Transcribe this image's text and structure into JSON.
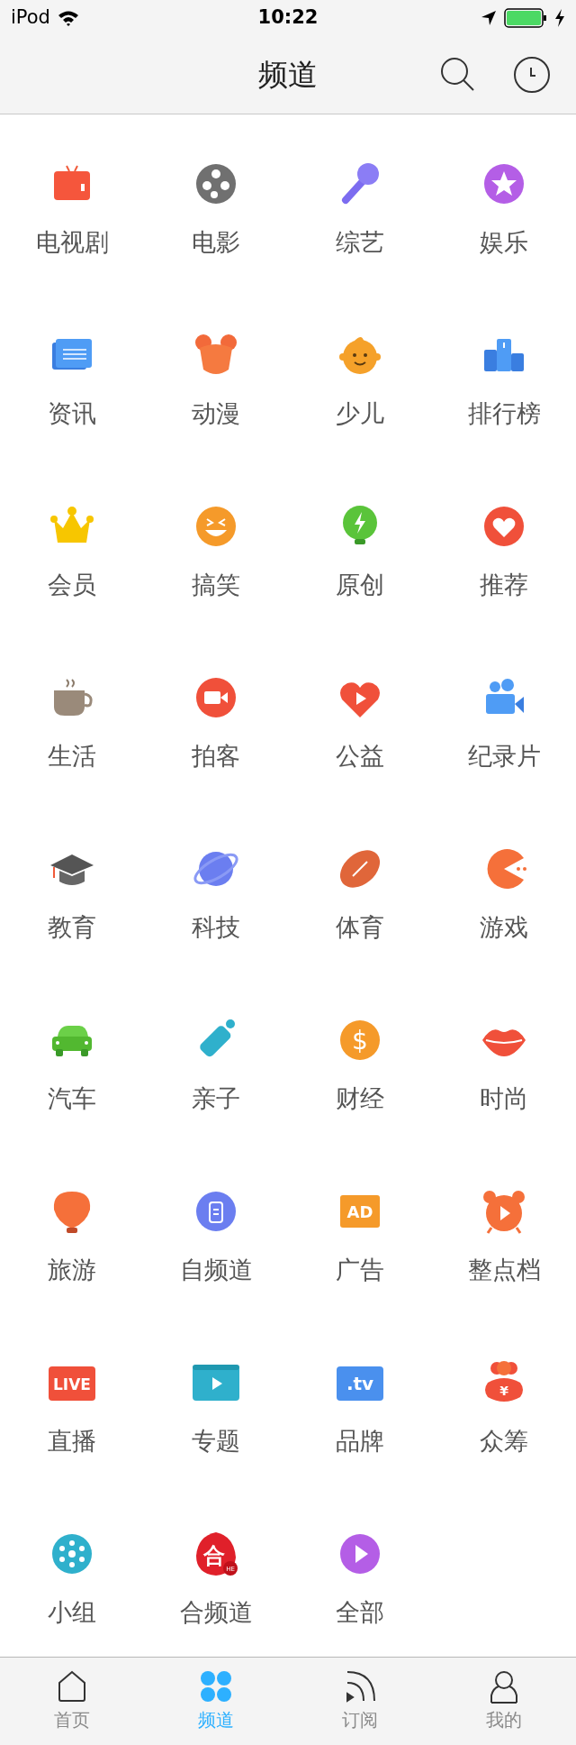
{
  "status_bar": {
    "device": "iPod",
    "time": "10:22"
  },
  "nav_bar": {
    "title": "频道"
  },
  "channels": [
    {
      "label": "电视剧"
    },
    {
      "label": "电影"
    },
    {
      "label": "综艺"
    },
    {
      "label": "娱乐"
    },
    {
      "label": "资讯"
    },
    {
      "label": "动漫"
    },
    {
      "label": "少儿"
    },
    {
      "label": "排行榜"
    },
    {
      "label": "会员"
    },
    {
      "label": "搞笑"
    },
    {
      "label": "原创"
    },
    {
      "label": "推荐"
    },
    {
      "label": "生活"
    },
    {
      "label": "拍客"
    },
    {
      "label": "公益"
    },
    {
      "label": "纪录片"
    },
    {
      "label": "教育"
    },
    {
      "label": "科技"
    },
    {
      "label": "体育"
    },
    {
      "label": "游戏"
    },
    {
      "label": "汽车"
    },
    {
      "label": "亲子"
    },
    {
      "label": "财经",
      "glyph": "$"
    },
    {
      "label": "时尚"
    },
    {
      "label": "旅游"
    },
    {
      "label": "自频道"
    },
    {
      "label": "广告",
      "glyph": "AD"
    },
    {
      "label": "整点档"
    },
    {
      "label": "直播",
      "glyph": "LIVE"
    },
    {
      "label": "专题"
    },
    {
      "label": "品牌",
      "glyph": ".tv"
    },
    {
      "label": "众筹",
      "glyph": "¥"
    },
    {
      "label": "小组"
    },
    {
      "label": "合频道",
      "glyph": "合",
      "sub_glyph": "HE"
    },
    {
      "label": "全部"
    }
  ],
  "tab_bar": [
    {
      "label": "首页",
      "selected": false
    },
    {
      "label": "频道",
      "selected": true
    },
    {
      "label": "订阅",
      "selected": false
    },
    {
      "label": "我的",
      "selected": false
    }
  ]
}
